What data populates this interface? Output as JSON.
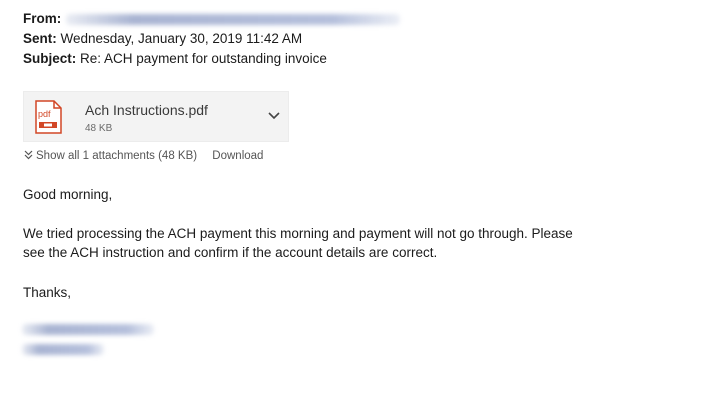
{
  "header": {
    "from_label": "From:",
    "sent_label": "Sent:",
    "sent_value": "Wednesday, January 30, 2019 11:42 AM",
    "subject_label": "Subject:",
    "subject_value": "Re: ACH payment for outstanding invoice"
  },
  "attachment": {
    "icon": "pdf-file-icon",
    "name": "Ach Instructions.pdf",
    "size": "48 KB",
    "show_all_label": "Show all 1 attachments (48 KB)",
    "download_label": "Download"
  },
  "body": {
    "greeting": "Good morning,",
    "paragraph_line_1": "We tried processing the ACH payment this morning and payment will not go through. Please",
    "paragraph_line_2": "see the ACH instruction and confirm if the account details are correct.",
    "closing": "Thanks,"
  },
  "colors": {
    "pdf_accent": "#d24726",
    "card_background": "#f3f3f3"
  }
}
